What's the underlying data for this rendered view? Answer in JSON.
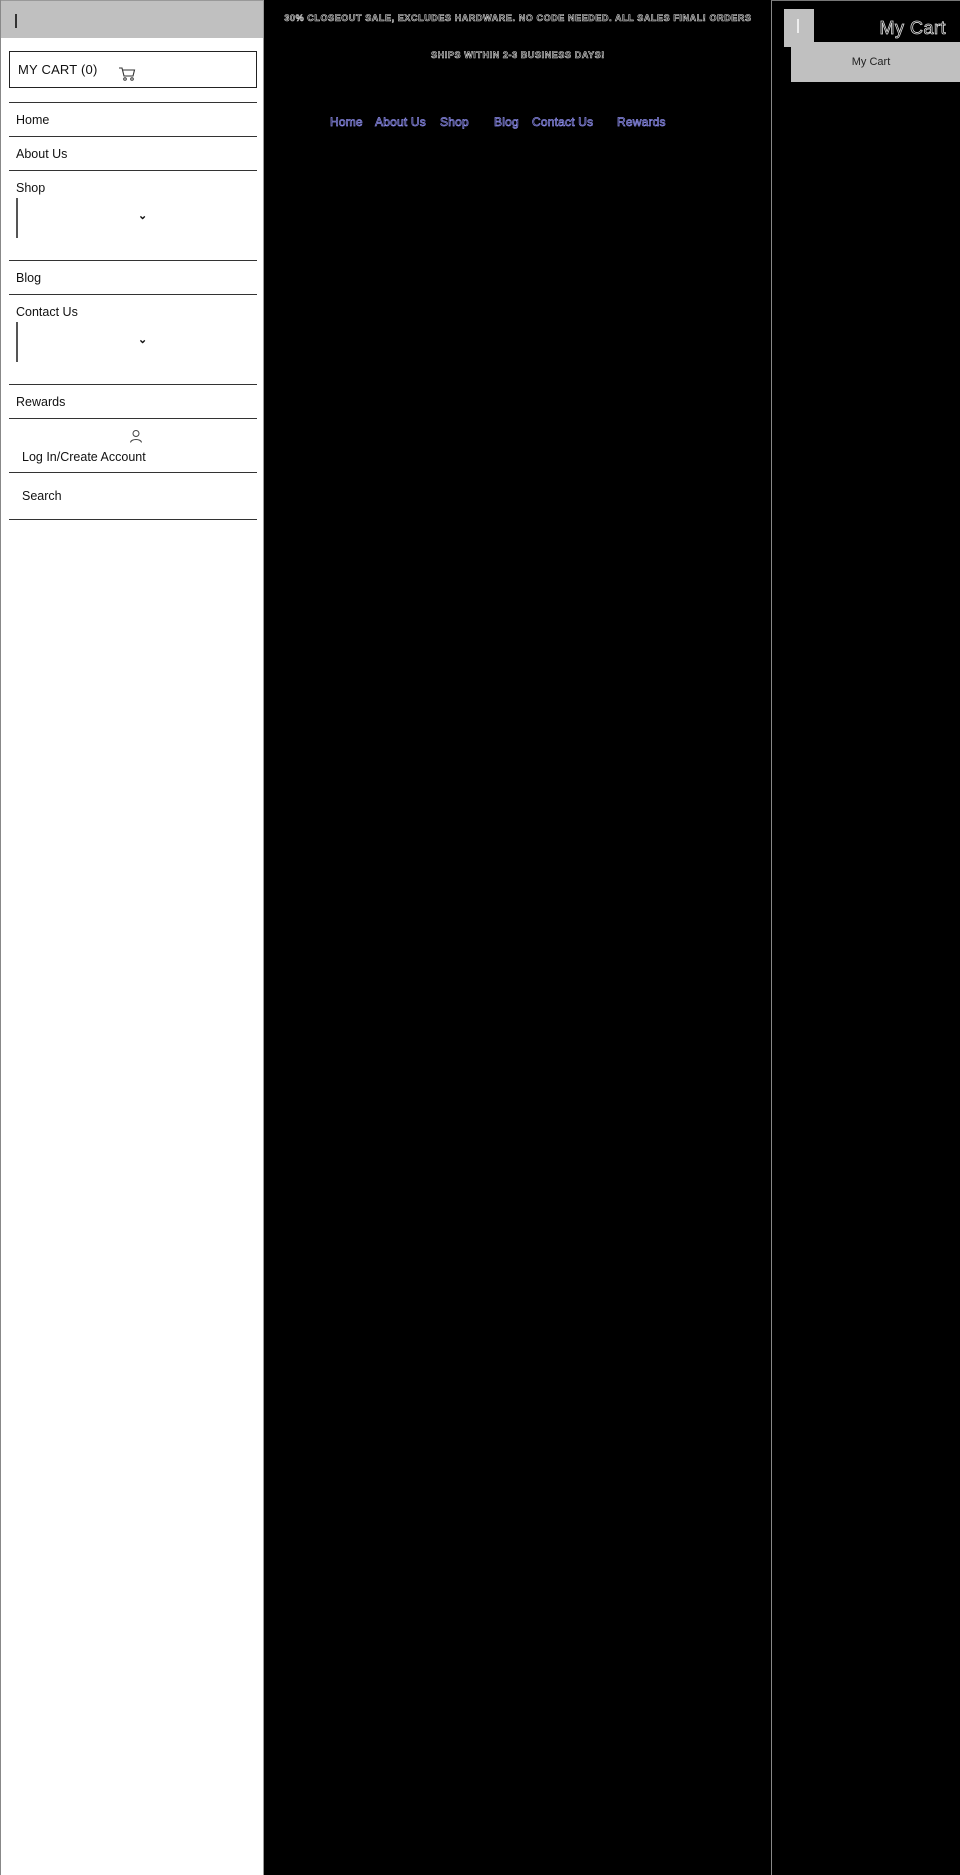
{
  "drawer": {
    "close_icon": "close-bar-icon",
    "cart_label": "MY CART (0)",
    "cart_icon": "cart-icon",
    "menu": [
      {
        "label": "Home",
        "type": "link"
      },
      {
        "label": "About Us",
        "type": "link"
      },
      {
        "label": "Shop",
        "type": "dropdown"
      },
      {
        "label": "Blog",
        "type": "link"
      },
      {
        "label": "Contact Us",
        "type": "dropdown"
      },
      {
        "label": "Rewards",
        "type": "link"
      }
    ],
    "login_label": "Log In/Create Account",
    "login_icon": "user-icon",
    "search_label": "Search",
    "dropdown_icon": "chevron-down-icon"
  },
  "announcement": {
    "line1": "30% CLOSEOUT SALE, EXCLUDES HARDWARE. NO CODE NEEDED. ALL SALES FINAL! ORDERS",
    "line2": "SHIPS WITHIN 2-3 BUSINESS DAYS!"
  },
  "nav": {
    "items": [
      "Home",
      "About Us",
      "Shop",
      "Blog",
      "Contact Us",
      "Rewards"
    ],
    "link_color": "#8a8ae8"
  },
  "cart_panel": {
    "title": "My Cart",
    "tab_label": "My Cart",
    "close_icon": "close-bar-icon"
  },
  "colors": {
    "background": "#000000",
    "drawer_bg": "#ffffff",
    "panel_gray": "#c0c0c0"
  }
}
